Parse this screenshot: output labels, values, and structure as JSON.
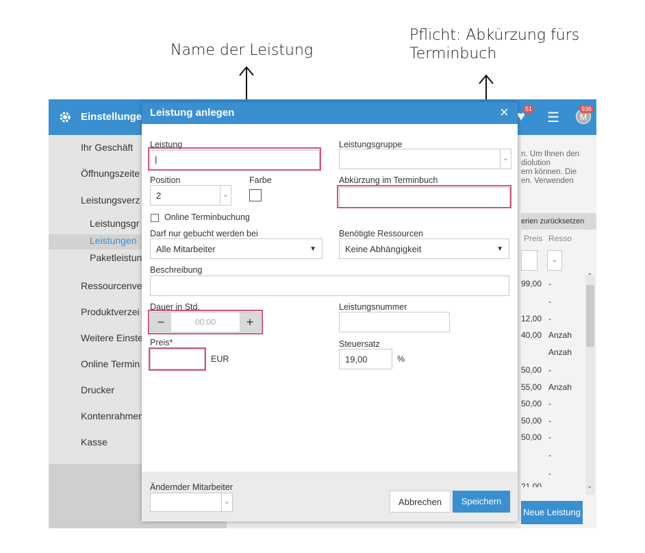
{
  "annotations": {
    "name_label": "Name der Leistung",
    "abk_line1": "Pflicht: Abkürzung fürs",
    "abk_line2": "Terminbuch"
  },
  "header": {
    "title": "Einstellunge",
    "badge_notifications": "51",
    "badge_user": "936",
    "avatar_letter": "M",
    "accent": "#3a8fd1"
  },
  "sidebar": {
    "items": [
      "Ihr Geschäft",
      "Öffnungszeite",
      "Leistungsverz",
      "Ressourcenve",
      "Produktverzei",
      "Weitere Einste",
      "Online Termin",
      "Drucker",
      "Kontenrahmen",
      "Kasse"
    ],
    "sub_items": [
      "Leistungsgr",
      "Leistungen",
      "Paketleistun"
    ]
  },
  "right_pane": {
    "info_lines": [
      "n. Um Ihnen den",
      "diolution",
      "ern können. Die",
      "en. Verwenden"
    ],
    "reset_label": "erien zurücksetzen",
    "col_preis": "Preis",
    "col_resso": "Resso",
    "prices": [
      "99,00",
      "",
      "12,00",
      "40,00",
      "",
      "50,00",
      "55,00",
      "50,00",
      "50,00",
      "50,00",
      "",
      "",
      "21,00"
    ],
    "resources": [
      "-",
      "-",
      "-",
      "Anzah",
      "Anzah",
      "-",
      "Anzah",
      "-",
      "-",
      "-",
      "-",
      "-",
      ""
    ],
    "new_button": "Neue Leistung"
  },
  "modal": {
    "title": "Leistung anlegen",
    "close": "×",
    "leistung_label": "Leistung",
    "leistung_value": "|",
    "gruppe_label": "Leistungsgruppe",
    "position_label": "Position",
    "position_value": "2",
    "farbe_label": "Farbe",
    "abk_label": "Abkürzung im Terminbuch",
    "online_label": "Online Terminbuchung",
    "darf_label": "Darf nur gebucht werden bei",
    "darf_value": "Alle Mitarbeiter",
    "ress_label": "Benötigte Ressourcen",
    "ress_value": "Keine Abhängigkeit",
    "beschreibung_label": "Beschreibung",
    "dauer_label": "Dauer in Std.",
    "dauer_value": "00:00",
    "dauer_minus": "−",
    "dauer_plus": "+",
    "nummer_label": "Leistungsnummer",
    "preis_label": "Preis*",
    "preis_unit": "EUR",
    "steuer_label": "Steuersatz",
    "steuer_value": "19,00",
    "steuer_unit": "%",
    "aendernder_label": "Ändernder Mitarbeiter",
    "cancel": "Abbrechen",
    "save": "Speichern",
    "highlight_color": "#d0547a"
  }
}
